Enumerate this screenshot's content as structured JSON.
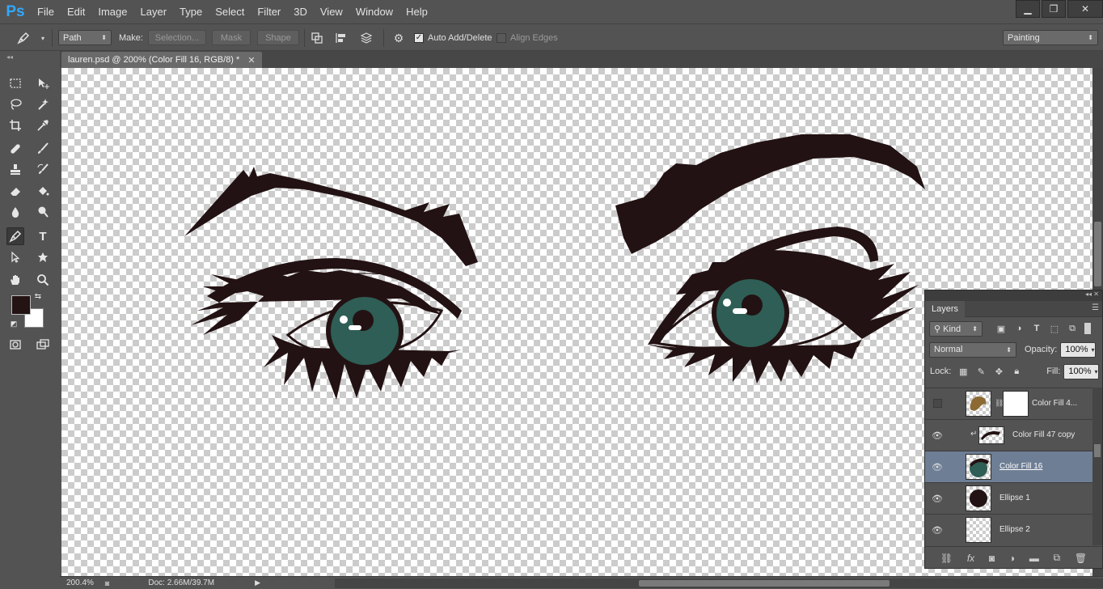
{
  "app": {
    "logo": "Ps"
  },
  "menu": [
    "File",
    "Edit",
    "Image",
    "Layer",
    "Type",
    "Select",
    "Filter",
    "3D",
    "View",
    "Window",
    "Help"
  ],
  "window_controls": {
    "minimize": "▁",
    "restore": "❐",
    "close": "✕"
  },
  "options": {
    "mode": "Path",
    "make_label": "Make:",
    "selection": "Selection...",
    "mask": "Mask",
    "shape": "Shape",
    "auto_add_delete": "Auto Add/Delete",
    "align_edges": "Align Edges",
    "workspace": "Painting"
  },
  "document": {
    "tab_title": "lauren.psd @ 200% (Color Fill 16, RGB/8) *",
    "zoom": "200.4%",
    "doc_info": "Doc: 2.66M/39.7M"
  },
  "colors": {
    "foreground": "#231313",
    "background": "#ffffff",
    "iris": "#2e5e55",
    "eyeline": "#231213"
  },
  "layers_panel": {
    "title": "Layers",
    "filter_kind": "Kind",
    "blend_mode": "Normal",
    "opacity_label": "Opacity:",
    "opacity": "100%",
    "lock_label": "Lock:",
    "fill_label": "Fill:",
    "fill": "100%",
    "layers": [
      {
        "name": "Color Fill 4...",
        "visible": false
      },
      {
        "name": "Color Fill 47 copy",
        "visible": true
      },
      {
        "name": "Color Fill 16",
        "visible": true,
        "selected": true
      },
      {
        "name": "Ellipse 1",
        "visible": true
      },
      {
        "name": "Ellipse 2",
        "visible": true
      }
    ]
  }
}
